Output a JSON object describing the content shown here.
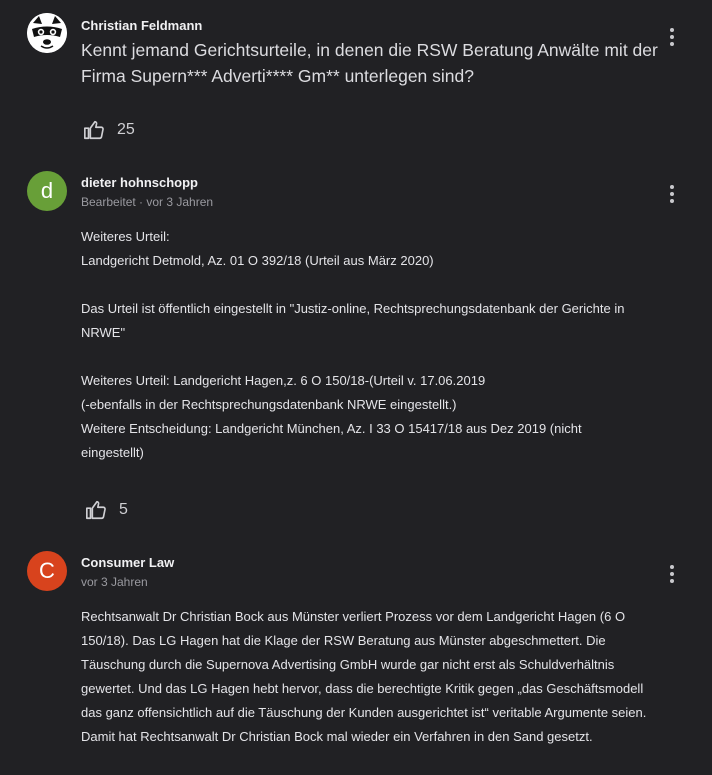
{
  "posts": [
    {
      "author": "Christian Feldmann",
      "avatar_letter": "",
      "avatar_color": "#ffffff",
      "text": "Kennt jemand Gerichtsurteile, in denen die RSW Beratung Anwälte mit der Firma Supern*** Adverti**** Gm** unterlegen sind?",
      "likes": "25"
    },
    {
      "author": "dieter hohnschopp",
      "meta": "Bearbeitet · vor 3 Jahren",
      "avatar_letter": "d",
      "avatar_color": "#689f38",
      "lines": [
        "Weiteres Urteil:",
        "Landgericht Detmold, Az. 01 O 392/18 (Urteil aus März 2020)",
        "Das Urteil ist öffentlich eingestellt in \"Justiz-online, Rechtsprechungsdatenbank der Gerichte in NRWE\"",
        "Weiteres Urteil: Landgericht Hagen,z. 6 O 150/18-(Urteil v. 17.06.2019",
        "(-ebenfalls in der Rechtsprechungsdatenbank NRWE eingestellt.)",
        "Weitere Entscheidung: Landgericht München, Az. I 33 O 15417/18 aus Dez 2019 (nicht eingestellt)"
      ],
      "likes": "5"
    },
    {
      "author": "Consumer Law",
      "meta": "vor 3 Jahren",
      "avatar_letter": "C",
      "avatar_color": "#d8431d",
      "text": "Rechtsanwalt Dr Christian Bock aus Münster verliert Prozess vor dem Landgericht Hagen (6 O 150/18). Das LG Hagen hat die Klage der RSW Beratung aus Münster abgeschmettert. Die Täuschung durch die Supernova Advertising GmbH wurde gar nicht erst als Schuldverhältnis gewertet. Und das LG Hagen hebt hervor, dass die berechtigte Kritik gegen „das Geschäftsmodell das ganz offensichtlich auf die Täuschung der Kunden ausgerichtet ist“ veritable Argumente seien. Damit hat Rechtsanwalt Dr Christian Bock mal wieder ein Verfahren in den Sand gesetzt."
    }
  ],
  "icons": {
    "like": "thumbs-up-icon",
    "more": "more-vert-icon"
  }
}
